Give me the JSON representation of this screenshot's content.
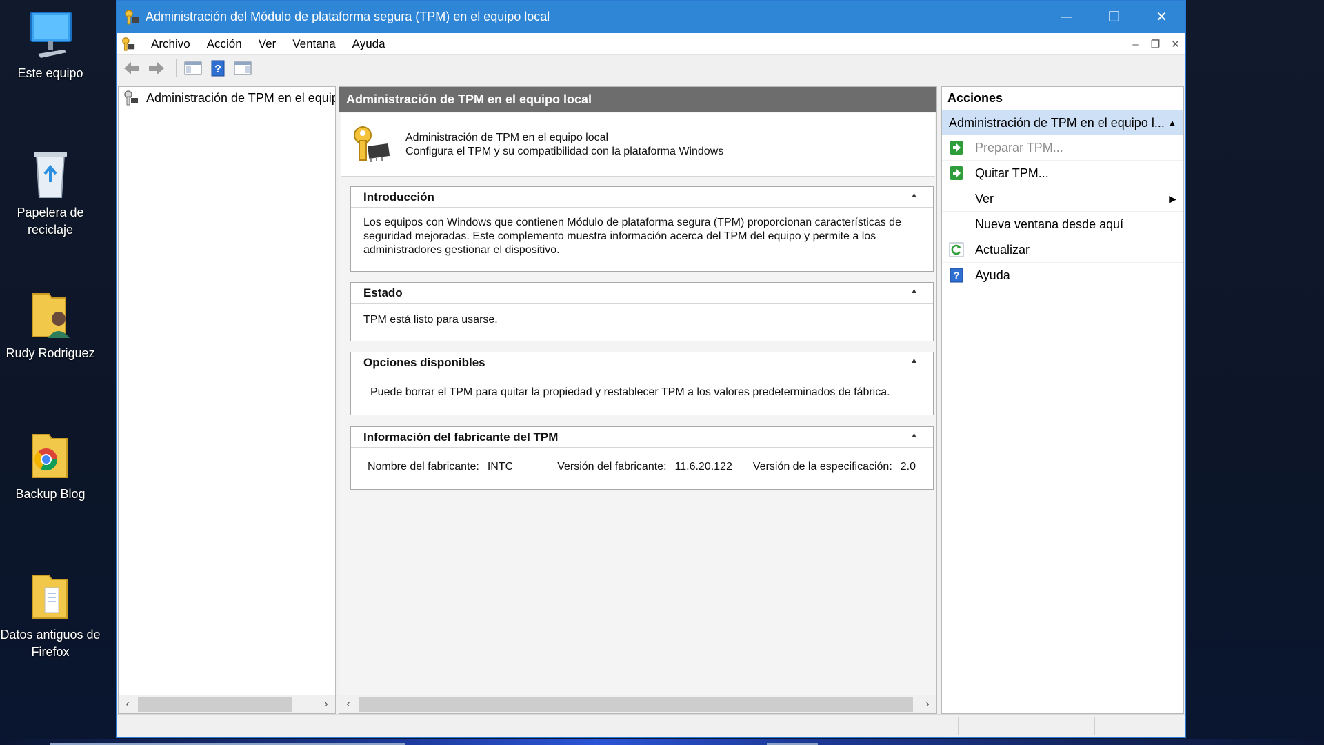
{
  "desktop": {
    "icons": [
      {
        "label": "Este equipo",
        "icon": "computer-icon"
      },
      {
        "label": "Papelera de reciclaje",
        "icon": "recycle-bin-icon"
      },
      {
        "label": "Rudy Rodriguez",
        "icon": "user-folder-icon"
      },
      {
        "label": "Backup Blog",
        "icon": "chrome-folder-icon"
      },
      {
        "label": "Datos antiguos de Firefox",
        "icon": "folder-icon"
      }
    ]
  },
  "window": {
    "title": "Administración del Módulo de plataforma segura (TPM) en el equipo local",
    "controls": {
      "minimize": "—",
      "maximize": "☐",
      "close": "✕"
    }
  },
  "menu": {
    "items": [
      "Archivo",
      "Acción",
      "Ver",
      "Ventana",
      "Ayuda"
    ],
    "mdi": {
      "minimize": "–",
      "restore": "❐",
      "close": "✕"
    }
  },
  "toolbar": {
    "buttons": [
      "back-arrow-icon",
      "forward-arrow-icon",
      "show-hide-tree-icon",
      "help-icon",
      "show-hide-action-pane-icon"
    ]
  },
  "tree": {
    "root_label": "Administración de TPM en el equipo local"
  },
  "center": {
    "header": "Administración de TPM en el equipo local",
    "intro_title": "Administración de TPM en el equipo local",
    "intro_subtitle": "Configura el TPM y su compatibilidad con la plataforma Windows",
    "sections": {
      "introduccion": {
        "title": "Introducción",
        "text": "Los equipos con Windows que contienen Módulo de plataforma segura (TPM) proporcionan características de seguridad mejoradas. Este complemento muestra información acerca del TPM del equipo y permite a los administradores gestionar el dispositivo."
      },
      "estado": {
        "title": "Estado",
        "text": "TPM está listo para usarse."
      },
      "opciones": {
        "title": "Opciones disponibles",
        "text": "Puede borrar el TPM para quitar la propiedad y restablecer TPM a los valores predeterminados de fábrica."
      },
      "fabricante": {
        "title": "Información del fabricante del TPM",
        "name_label": "Nombre del fabricante:",
        "name_value": "INTC",
        "version_label": "Versión del fabricante:",
        "version_value": "11.6.20.122",
        "spec_label": "Versión de la especificación:",
        "spec_value": "2.0"
      }
    }
  },
  "actions": {
    "title": "Acciones",
    "group": "Administración de TPM en el equipo l...",
    "items": [
      {
        "label": "Preparar TPM...",
        "icon": "green-arrow-icon",
        "enabled": false
      },
      {
        "label": "Quitar TPM...",
        "icon": "green-arrow-icon",
        "enabled": true
      },
      {
        "label": "Ver",
        "icon": "",
        "enabled": true,
        "submenu": true
      },
      {
        "label": "Nueva ventana desde aquí",
        "icon": "",
        "enabled": true
      },
      {
        "label": "Actualizar",
        "icon": "refresh-icon",
        "enabled": true
      },
      {
        "label": "Ayuda",
        "icon": "help-icon",
        "enabled": true
      }
    ]
  },
  "colors": {
    "titlebar": "#2f86d6",
    "center_header": "#6d6d6d",
    "actions_group": "#cde0f5",
    "action_green": "#2e9d3a"
  }
}
